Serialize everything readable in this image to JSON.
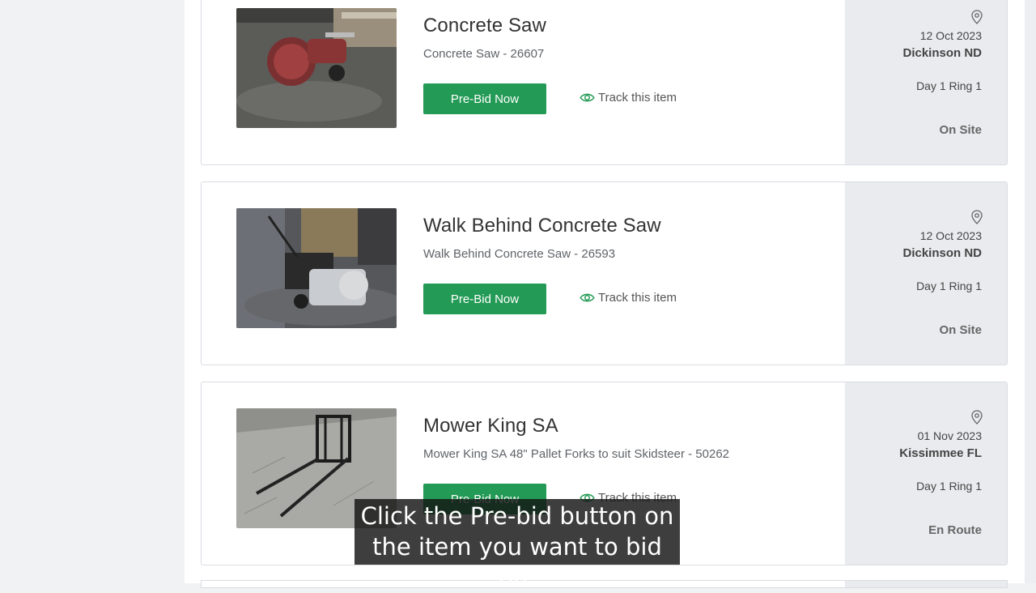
{
  "items": [
    {
      "title": "Concrete Saw",
      "subtitle": "Concrete Saw - 26607",
      "button_label": "Pre-Bid Now",
      "track_label": "Track this item",
      "date": "12 Oct 2023",
      "location": "Dickinson ND",
      "ring": "Day 1 Ring 1",
      "status": "On Site"
    },
    {
      "title": "Walk Behind Concrete Saw",
      "subtitle": "Walk Behind Concrete Saw - 26593",
      "button_label": "Pre-Bid Now",
      "track_label": "Track this item",
      "date": "12 Oct 2023",
      "location": "Dickinson ND",
      "ring": "Day 1 Ring 1",
      "status": "On Site"
    },
    {
      "title": "Mower King SA",
      "subtitle": "Mower King SA 48\" Pallet Forks to suit Skidsteer - 50262",
      "button_label": "Pre-Bid Now",
      "track_label": "Track this item",
      "date": "01 Nov 2023",
      "location": "Kissimmee FL",
      "ring": "Day 1 Ring 1",
      "status": "En Route"
    }
  ],
  "caption": {
    "line1": "Click the Pre-bid button on",
    "line2": "the item you want to bid on."
  },
  "colors": {
    "accent_green": "#239a55",
    "side_panel": "#e9ebee"
  },
  "icons": [
    "location-pin-icon",
    "eye-icon"
  ]
}
